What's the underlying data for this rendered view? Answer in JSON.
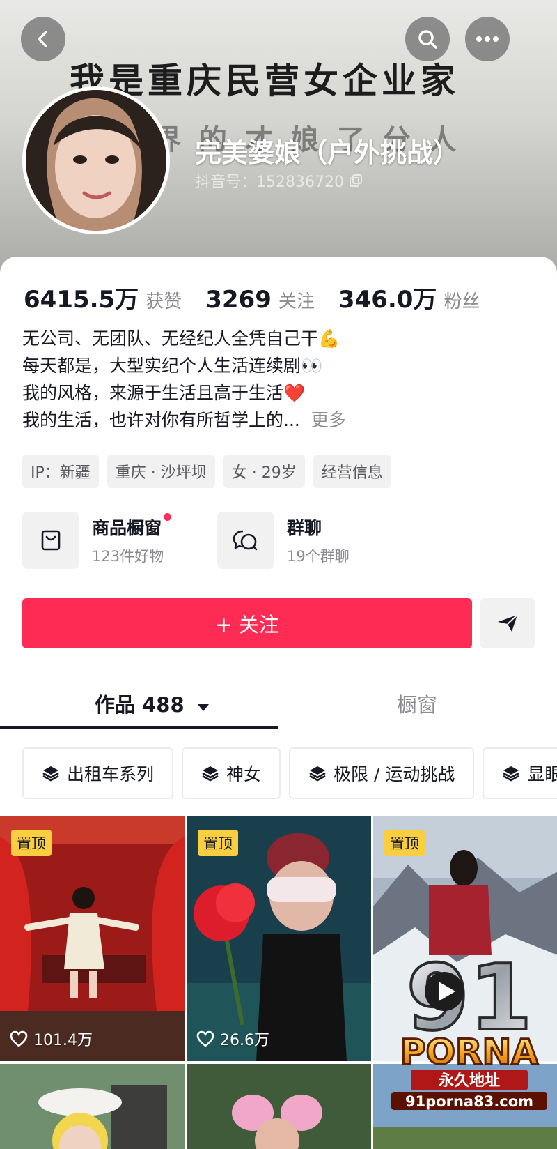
{
  "header": {
    "banner_line1": "我是重庆民营女企业家",
    "banner_line2": "界 的 才 娘 了 分 人",
    "nickname": "完美婆娘（户外挑战）",
    "douyin_id": "抖音号：152836720"
  },
  "stats": [
    {
      "value": "6415.5万",
      "label": "获赞"
    },
    {
      "value": "3269",
      "label": "关注"
    },
    {
      "value": "346.0万",
      "label": "粉丝"
    }
  ],
  "bio": {
    "lines": [
      "无公司、无团队、无经纪人全凭自己干💪",
      "每天都是，大型实纪个人生活连续剧👀",
      "我的风格，来源于生活且高于生活❤️",
      "我的生活，也许对你有所哲学上的..."
    ],
    "more": "更多"
  },
  "tags": [
    "IP：新疆",
    "重庆 · 沙坪坝",
    "女 · 29岁",
    "经营信息"
  ],
  "entries": [
    {
      "title": "商品橱窗",
      "sub": "123件好物",
      "icon": "shopping-bag-icon"
    },
    {
      "title": "群聊",
      "sub": "19个群聊",
      "icon": "chat-bubbles-icon"
    }
  ],
  "follow_label": "+ 关注",
  "tabs": {
    "works": "作品 488",
    "shop": "橱窗"
  },
  "chips": [
    "出租车系列",
    "神女",
    "极限 / 运动挑战",
    "显眼"
  ],
  "videos": [
    {
      "pinned": "置顶",
      "likes": "101.4万"
    },
    {
      "pinned": "置顶",
      "likes": "26.6万"
    },
    {
      "pinned": "置顶",
      "likes": ""
    }
  ],
  "watermark": {
    "brand_number": "91",
    "brand": "PORNA",
    "line": "永久地址",
    "url": "91porna83.com"
  },
  "colors": {
    "accent": "#fe2c55",
    "pin": "#facf3f",
    "muted": "#8a8b91"
  }
}
